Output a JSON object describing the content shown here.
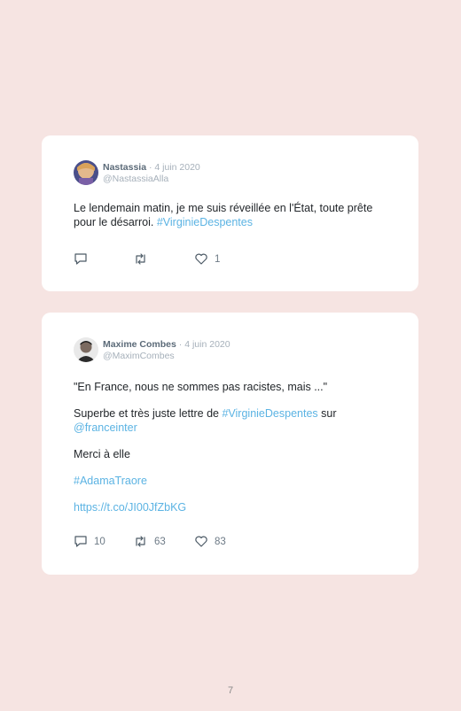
{
  "tweets": [
    {
      "name": "Nastassia",
      "separator": "·",
      "date": "4 juin 2020",
      "handle": "@NastassiaAlla",
      "body_text": "Le lendemain matin, je me suis réveillée en l'État, toute prête pour le désarroi. ",
      "body_hashtag": "#VirginieDespentes",
      "reply_count": "",
      "retweet_count": "",
      "like_count": "1"
    },
    {
      "name": "Maxime Combes",
      "separator": "·",
      "date": "4 juin 2020",
      "handle": "@MaximCombes",
      "quote": "\"En France, nous ne sommes pas racistes, mais ...\"",
      "line2_prefix": "Superbe et très juste lettre de ",
      "line2_hashtag": "#VirginieDespentes",
      "line2_mid": " sur",
      "line2_mention": "@franceinter",
      "line3": "Merci à elle",
      "hashtag2": "#AdamaTraore",
      "url": "https://t.co/JI00JfZbKG",
      "reply_count": "10",
      "retweet_count": "63",
      "like_count": "83"
    }
  ],
  "page_number": "7",
  "colors": {
    "background": "#f6e4e2",
    "link": "#5bb3e3",
    "name": "#5b6a78",
    "muted": "#a6b0ba"
  },
  "icons": [
    "reply-icon",
    "retweet-icon",
    "like-icon"
  ]
}
